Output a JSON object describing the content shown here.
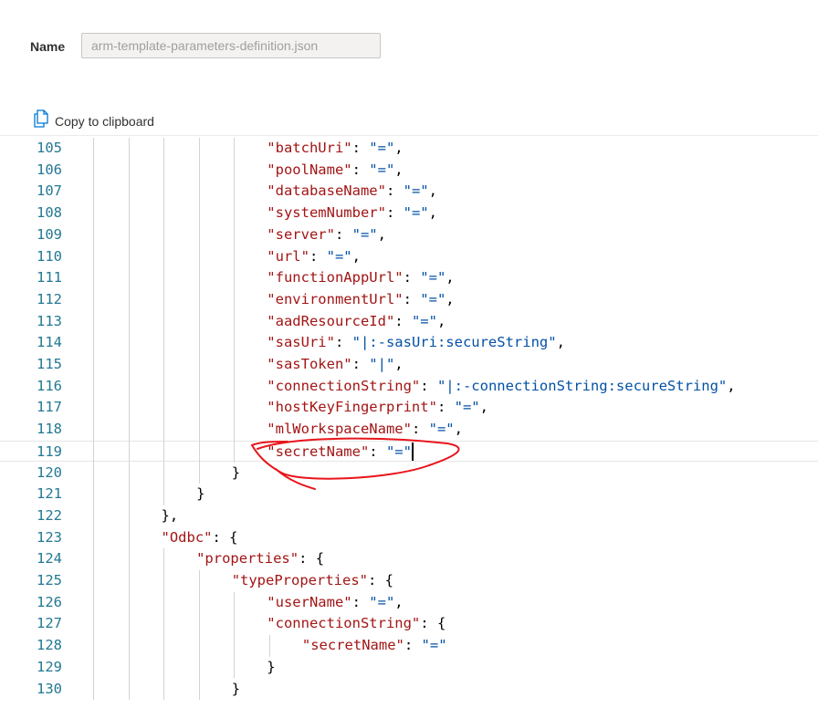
{
  "name_field": {
    "label": "Name",
    "value": "arm-template-parameters-definition.json"
  },
  "copy_button": {
    "label": "Copy to clipboard",
    "icon": "copy-icon"
  },
  "editor": {
    "lines": [
      {
        "num": "105",
        "indent": 5,
        "tokens": [
          {
            "t": "k",
            "v": "\"batchUri\""
          },
          {
            "t": "p",
            "v": ": "
          },
          {
            "t": "s",
            "v": "\"=\""
          },
          {
            "t": "p",
            "v": ","
          }
        ]
      },
      {
        "num": "106",
        "indent": 5,
        "tokens": [
          {
            "t": "k",
            "v": "\"poolName\""
          },
          {
            "t": "p",
            "v": ": "
          },
          {
            "t": "s",
            "v": "\"=\""
          },
          {
            "t": "p",
            "v": ","
          }
        ]
      },
      {
        "num": "107",
        "indent": 5,
        "tokens": [
          {
            "t": "k",
            "v": "\"databaseName\""
          },
          {
            "t": "p",
            "v": ": "
          },
          {
            "t": "s",
            "v": "\"=\""
          },
          {
            "t": "p",
            "v": ","
          }
        ]
      },
      {
        "num": "108",
        "indent": 5,
        "tokens": [
          {
            "t": "k",
            "v": "\"systemNumber\""
          },
          {
            "t": "p",
            "v": ": "
          },
          {
            "t": "s",
            "v": "\"=\""
          },
          {
            "t": "p",
            "v": ","
          }
        ]
      },
      {
        "num": "109",
        "indent": 5,
        "tokens": [
          {
            "t": "k",
            "v": "\"server\""
          },
          {
            "t": "p",
            "v": ": "
          },
          {
            "t": "s",
            "v": "\"=\""
          },
          {
            "t": "p",
            "v": ","
          }
        ]
      },
      {
        "num": "110",
        "indent": 5,
        "tokens": [
          {
            "t": "k",
            "v": "\"url\""
          },
          {
            "t": "p",
            "v": ": "
          },
          {
            "t": "s",
            "v": "\"=\""
          },
          {
            "t": "p",
            "v": ","
          }
        ]
      },
      {
        "num": "111",
        "indent": 5,
        "tokens": [
          {
            "t": "k",
            "v": "\"functionAppUrl\""
          },
          {
            "t": "p",
            "v": ": "
          },
          {
            "t": "s",
            "v": "\"=\""
          },
          {
            "t": "p",
            "v": ","
          }
        ]
      },
      {
        "num": "112",
        "indent": 5,
        "tokens": [
          {
            "t": "k",
            "v": "\"environmentUrl\""
          },
          {
            "t": "p",
            "v": ": "
          },
          {
            "t": "s",
            "v": "\"=\""
          },
          {
            "t": "p",
            "v": ","
          }
        ]
      },
      {
        "num": "113",
        "indent": 5,
        "tokens": [
          {
            "t": "k",
            "v": "\"aadResourceId\""
          },
          {
            "t": "p",
            "v": ": "
          },
          {
            "t": "s",
            "v": "\"=\""
          },
          {
            "t": "p",
            "v": ","
          }
        ]
      },
      {
        "num": "114",
        "indent": 5,
        "tokens": [
          {
            "t": "k",
            "v": "\"sasUri\""
          },
          {
            "t": "p",
            "v": ": "
          },
          {
            "t": "s",
            "v": "\"|:-sasUri:secureString\""
          },
          {
            "t": "p",
            "v": ","
          }
        ]
      },
      {
        "num": "115",
        "indent": 5,
        "tokens": [
          {
            "t": "k",
            "v": "\"sasToken\""
          },
          {
            "t": "p",
            "v": ": "
          },
          {
            "t": "s",
            "v": "\"|\""
          },
          {
            "t": "p",
            "v": ","
          }
        ]
      },
      {
        "num": "116",
        "indent": 5,
        "tokens": [
          {
            "t": "k",
            "v": "\"connectionString\""
          },
          {
            "t": "p",
            "v": ": "
          },
          {
            "t": "s",
            "v": "\"|:-connectionString:secureString\""
          },
          {
            "t": "p",
            "v": ","
          }
        ]
      },
      {
        "num": "117",
        "indent": 5,
        "tokens": [
          {
            "t": "k",
            "v": "\"hostKeyFingerprint\""
          },
          {
            "t": "p",
            "v": ": "
          },
          {
            "t": "s",
            "v": "\"=\""
          },
          {
            "t": "p",
            "v": ","
          }
        ]
      },
      {
        "num": "118",
        "indent": 5,
        "tokens": [
          {
            "t": "k",
            "v": "\"mlWorkspaceName\""
          },
          {
            "t": "p",
            "v": ": "
          },
          {
            "t": "s",
            "v": "\"=\""
          },
          {
            "t": "p",
            "v": ","
          }
        ]
      },
      {
        "num": "119",
        "indent": 5,
        "current": true,
        "tokens": [
          {
            "t": "k",
            "v": "\"secretName\""
          },
          {
            "t": "p",
            "v": ": "
          },
          {
            "t": "s",
            "v": "\"=\""
          }
        ]
      },
      {
        "num": "120",
        "indent": 4,
        "tokens": [
          {
            "t": "p",
            "v": "}"
          }
        ]
      },
      {
        "num": "121",
        "indent": 3,
        "tokens": [
          {
            "t": "p",
            "v": "}"
          }
        ]
      },
      {
        "num": "122",
        "indent": 2,
        "tokens": [
          {
            "t": "p",
            "v": "},"
          }
        ]
      },
      {
        "num": "123",
        "indent": 2,
        "tokens": [
          {
            "t": "k",
            "v": "\"Odbc\""
          },
          {
            "t": "p",
            "v": ": {"
          }
        ]
      },
      {
        "num": "124",
        "indent": 3,
        "tokens": [
          {
            "t": "k",
            "v": "\"properties\""
          },
          {
            "t": "p",
            "v": ": {"
          }
        ]
      },
      {
        "num": "125",
        "indent": 4,
        "tokens": [
          {
            "t": "k",
            "v": "\"typeProperties\""
          },
          {
            "t": "p",
            "v": ": {"
          }
        ]
      },
      {
        "num": "126",
        "indent": 5,
        "tokens": [
          {
            "t": "k",
            "v": "\"userName\""
          },
          {
            "t": "p",
            "v": ": "
          },
          {
            "t": "s",
            "v": "\"=\""
          },
          {
            "t": "p",
            "v": ","
          }
        ]
      },
      {
        "num": "127",
        "indent": 5,
        "tokens": [
          {
            "t": "k",
            "v": "\"connectionString\""
          },
          {
            "t": "p",
            "v": ": {"
          }
        ]
      },
      {
        "num": "128",
        "indent": 6,
        "tokens": [
          {
            "t": "k",
            "v": "\"secretName\""
          },
          {
            "t": "p",
            "v": ": "
          },
          {
            "t": "s",
            "v": "\"=\""
          }
        ]
      },
      {
        "num": "129",
        "indent": 5,
        "tokens": [
          {
            "t": "p",
            "v": "}"
          }
        ]
      },
      {
        "num": "130",
        "indent": 4,
        "tokens": [
          {
            "t": "p",
            "v": "}"
          }
        ]
      }
    ],
    "colors": {
      "key": "#a31515",
      "string": "#0451a5",
      "line_number": "#237893",
      "annotation": "#e8141b"
    }
  }
}
